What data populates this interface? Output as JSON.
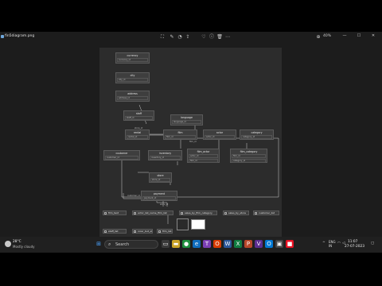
{
  "window": {
    "title": "fin5diagram.png",
    "zoom": "40%",
    "minimize": "—",
    "maximize": "☐",
    "close": "✕"
  },
  "nodes": [
    {
      "name": "currency",
      "row": "currency_id"
    },
    {
      "name": "city",
      "row": "city_id"
    },
    {
      "name": "address",
      "row": "address_id"
    },
    {
      "name": "staff",
      "row": "staff_id"
    },
    {
      "name": "language",
      "row": "language_id"
    },
    {
      "name": "rental",
      "row": "rental_id"
    },
    {
      "name": "film",
      "row": "film_id"
    },
    {
      "name": "actor",
      "row": "actor_id"
    },
    {
      "name": "category",
      "row": "category_id"
    },
    {
      "name": "film_actor",
      "row": "actor_id"
    },
    {
      "name": "film_category",
      "row": "film_id"
    },
    {
      "name": "customer",
      "row": "customer_id"
    },
    {
      "name": "inventory",
      "row": "inventory_id"
    },
    {
      "name": "store",
      "row": "store_id"
    },
    {
      "name": "payment",
      "row": "payment_id"
    }
  ],
  "legend": [
    "film_text",
    "actor_list_name_film_list",
    "sales_by_film_category",
    "sales_by_store",
    "customer_list",
    "staff_list",
    "nicer_but_slower_film_list",
    "film_list"
  ],
  "taskbar": {
    "weather_temp": "28°C",
    "weather_desc": "Mostly cloudy",
    "search_placeholder": "Search",
    "lang_line1": "ENG",
    "lang_line2": "IN",
    "time": "11:07",
    "date": "27-07-2023"
  }
}
